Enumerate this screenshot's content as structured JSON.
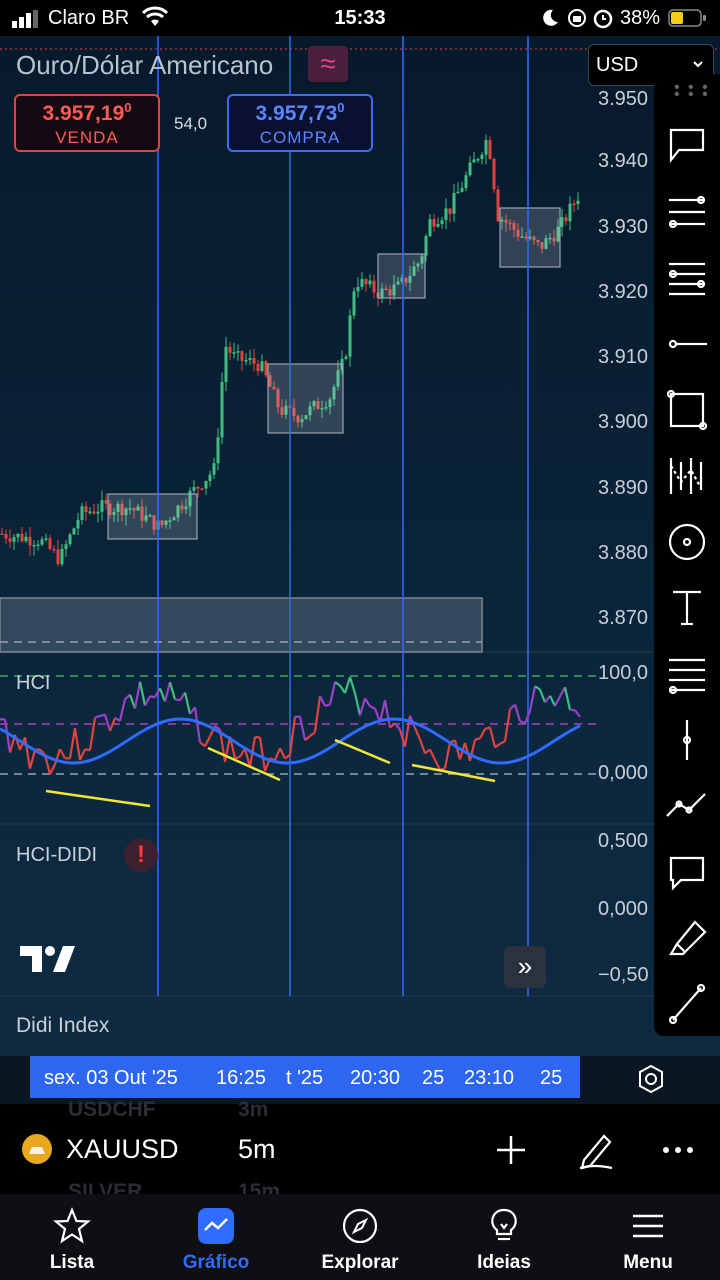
{
  "status_bar": {
    "carrier": "Claro BR",
    "time": "15:33",
    "battery": "38%"
  },
  "chart": {
    "symbol_title": "Ouro/Dólar Americano",
    "sell": {
      "price": "3.957,19",
      "sup": "0",
      "label": "VENDA"
    },
    "buy": {
      "price": "3.957,73",
      "sup": "0",
      "label": "COMPRA"
    },
    "spread": "54,0",
    "currency": "USD",
    "price_axis": [
      "3.950",
      "3.940",
      "3.930",
      "3.920",
      "3.910",
      "3.900",
      "3.890",
      "3.880",
      "3.870"
    ],
    "hci_panel": {
      "label": "HCI",
      "axis": [
        "100,0",
        "0,000"
      ]
    },
    "didi_panel": {
      "label": "HCI-DIDI",
      "axis": [
        "0,500",
        "0,000",
        "−0,50"
      ]
    },
    "didi_index_label": "Didi Index",
    "time_bar": {
      "parts": [
        "sex. 03 Out '25",
        "16:25",
        "t '25",
        "20:30",
        "25",
        "23:10",
        "25"
      ]
    }
  },
  "toolbar": {
    "tools": [
      "callout-icon",
      "fib-retracement-icon",
      "fib-extension-icon",
      "horizontal-ray-icon",
      "rectangle-icon",
      "pattern-icon",
      "ellipse-icon",
      "text-icon",
      "parallel-channel-icon",
      "vertical-line-icon",
      "path-icon",
      "comment-icon",
      "highlighter-icon",
      "trend-line-icon"
    ]
  },
  "symbol_bar": {
    "symbol": "XAUUSD",
    "interval": "5m",
    "ghost_above": [
      "USDCHF",
      "3m"
    ],
    "ghost_below": [
      "SILVER",
      "15m"
    ]
  },
  "nav": [
    {
      "label": "Lista",
      "icon": "star-icon",
      "active": false
    },
    {
      "label": "Gráfico",
      "icon": "chart-icon",
      "active": true
    },
    {
      "label": "Explorar",
      "icon": "compass-icon",
      "active": false
    },
    {
      "label": "Ideias",
      "icon": "bulb-icon",
      "active": false
    },
    {
      "label": "Menu",
      "icon": "menu-icon",
      "active": false
    }
  ],
  "colors": {
    "up": "#3fbf7f",
    "down": "#e0443f",
    "hci_blue": "#2f6bff",
    "divergence": "#f2e53a",
    "accent": "#2e66f0",
    "sell": "#ff5a55",
    "buy": "#5b86ff"
  }
}
